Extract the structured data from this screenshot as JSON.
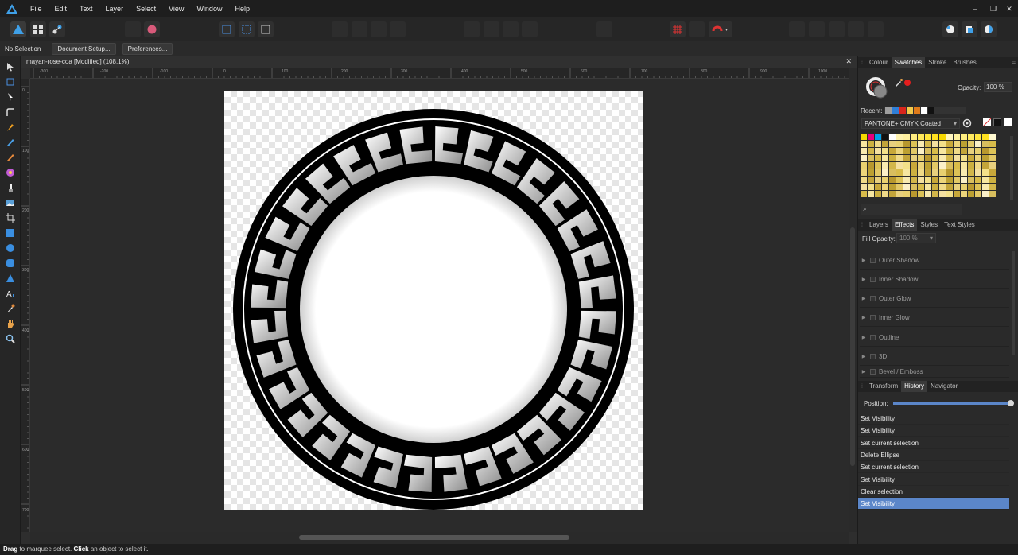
{
  "menubar": {
    "items": [
      "File",
      "Edit",
      "Text",
      "Layer",
      "Select",
      "View",
      "Window",
      "Help"
    ],
    "window_controls": [
      "–",
      "❐",
      "✕"
    ]
  },
  "contextbar": {
    "selection": "No Selection",
    "document_setup": "Document Setup...",
    "preferences": "Preferences..."
  },
  "document": {
    "tab_title": "mayan-rose-coa [Modified] (108.1%)",
    "close": "✕",
    "ruler_top": [
      "-300",
      "-200",
      "-100",
      "0",
      "100",
      "200",
      "300",
      "400",
      "500",
      "600",
      "700",
      "800",
      "900",
      "1000"
    ],
    "ruler_left": [
      "0",
      "100",
      "200",
      "300",
      "400",
      "500",
      "600",
      "700"
    ]
  },
  "colour_panel": {
    "tabs": [
      "Colour",
      "Swatches",
      "Stroke",
      "Brushes"
    ],
    "active_tab": "Swatches",
    "opacity_label": "Opacity:",
    "opacity_value": "100 %",
    "recent_label": "Recent:",
    "palette_name": "PANTONE+ CMYK Coated",
    "recent_colors": [
      "#9e9e9e",
      "#2f7fd8",
      "#d9261c",
      "#f2c94c",
      "#e07b1a",
      "#ffffff",
      "#111111"
    ]
  },
  "effects_panel": {
    "tabs": [
      "Layers",
      "Effects",
      "Styles",
      "Text Styles"
    ],
    "active_tab": "Effects",
    "fill_opacity_label": "Fill Opacity:",
    "fill_opacity_value": "100 %",
    "effects": [
      "Outer Shadow",
      "Inner Shadow",
      "Outer Glow",
      "Inner Glow",
      "Outline",
      "3D",
      "Bevel / Emboss"
    ]
  },
  "history_panel": {
    "tabs": [
      "Transform",
      "History",
      "Navigator"
    ],
    "active_tab": "History",
    "position_label": "Position:",
    "position_fraction": 1.0,
    "entries": [
      "Set Visibility",
      "Set Visibility",
      "Set current selection",
      "Delete Ellipse",
      "Set current selection",
      "Set Visibility",
      "Clear selection",
      "Set Visibility"
    ],
    "selected_index": 7
  },
  "status": {
    "drag": "Drag",
    "t1": " to marquee select. ",
    "click": "Click",
    "t2": " an object to select it."
  },
  "colors": {
    "accent": "#5b86c9",
    "app_bg": "#2e2e2e",
    "artwork_black": "#000000"
  }
}
